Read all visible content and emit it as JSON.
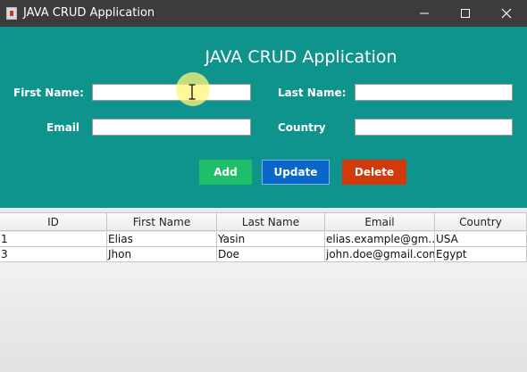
{
  "window": {
    "title": "JAVA CRUD Application"
  },
  "header": {
    "title": "JAVA CRUD Application"
  },
  "form": {
    "first_name_label": "First Name:",
    "last_name_label": "Last Name:",
    "email_label": "Email",
    "country_label": "Country",
    "first_name_value": "",
    "last_name_value": "",
    "email_value": "",
    "country_value": ""
  },
  "buttons": {
    "add": "Add",
    "update": "Update",
    "delete": "Delete"
  },
  "colors": {
    "panel": "#0e938d",
    "add": "#1fbf6a",
    "update": "#0a66c8",
    "delete": "#d23a0c"
  },
  "table": {
    "columns": [
      "ID",
      "First Name",
      "Last Name",
      "Email",
      "Country"
    ],
    "rows": [
      [
        "1",
        "Elias",
        "Yasin",
        "elias.example@gm...",
        "USA"
      ],
      [
        "3",
        "Jhon",
        "Doe",
        "john.doe@gmail.com",
        "Egypt"
      ]
    ]
  }
}
